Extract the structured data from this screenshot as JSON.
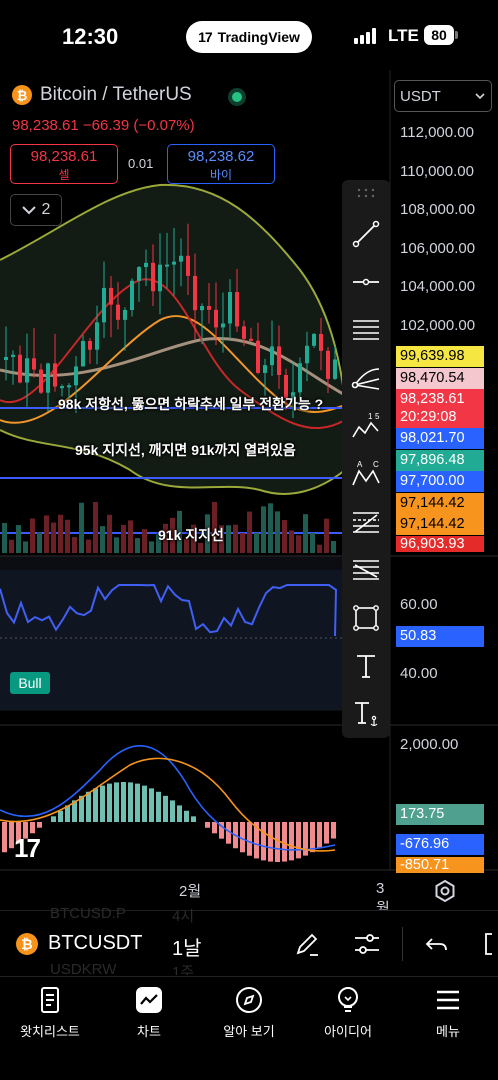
{
  "status": {
    "time": "12:30",
    "pill_brand": "TradingView",
    "network": "LTE",
    "battery": "80"
  },
  "header": {
    "symbol_title": "Bitcoin / TetherUS",
    "price_line": "98,238.61 −66.39 (−0.07%)",
    "sell_price": "98,238.61",
    "sell_label": "셀",
    "spread": "0.01",
    "buy_price": "98,238.62",
    "buy_label": "바이",
    "collapse_count": "2",
    "currency": "USDT"
  },
  "price_axis": [
    "112,000.00",
    "110,000.00",
    "108,000.00",
    "106,000.00",
    "104,000.00",
    "102,000.00"
  ],
  "price_tags": [
    {
      "text": "99,639.98",
      "bg": "#f5e642",
      "fg": "#000"
    },
    {
      "text": "98,470.54",
      "bg": "#f4c6cd",
      "fg": "#000"
    },
    {
      "text": "98,238.61",
      "bg": "#f23645",
      "fg": "#fff"
    },
    {
      "text": "20:29:08",
      "bg": "#f23645",
      "fg": "#fff"
    },
    {
      "text": "98,021.70",
      "bg": "#2962ff",
      "fg": "#fff"
    },
    {
      "text": "97,896.48",
      "bg": "#22ab94",
      "fg": "#fff"
    },
    {
      "text": "97,700.00",
      "bg": "#2962ff",
      "fg": "#fff"
    },
    {
      "text": "97,144.42",
      "bg": "#f7941d",
      "fg": "#000"
    },
    {
      "text": "97,144.42",
      "bg": "#f7941d",
      "fg": "#000"
    },
    {
      "text": "96,903.93",
      "bg": "#e52a2a",
      "fg": "#fff"
    }
  ],
  "annotations": {
    "line1": "98k 저항선, 뚫으면 하락추세 일부 전환가능 ?",
    "line2": "95k 지지선, 깨지면 91k까지 열려있음",
    "line3": "91k 지지선"
  },
  "rsi": {
    "level_high": "60.00",
    "level_low": "40.00",
    "value": "50.83",
    "badge": "Bull"
  },
  "macd": {
    "axis_top": "2,000.00",
    "hist": "173.75",
    "macd": "-676.96",
    "signal": "-850.71"
  },
  "time_axis": {
    "label_feb": "2월",
    "label_mar": "3월"
  },
  "symbol_bar": {
    "symbol": "BTCUSDT",
    "interval": "1날",
    "ghost1": "BTCUSD.P",
    "ghost1_iv": "4시",
    "ghost2": "USDKRW",
    "ghost2_iv": "1주"
  },
  "draw_tools": [
    "trend-line",
    "horizontal-ray",
    "parallel-channel",
    "pitchfork",
    "xabcd-pattern",
    "abcd-pattern",
    "fib-retracement",
    "fib-extension",
    "rectangle",
    "text",
    "anchored-text"
  ],
  "nav": [
    "왓치리스트",
    "차트",
    "알아 보기",
    "아이디어",
    "메뉴"
  ],
  "colors": {
    "up": "#22ab94",
    "down": "#f23645",
    "accent_blue": "#2962ff"
  }
}
